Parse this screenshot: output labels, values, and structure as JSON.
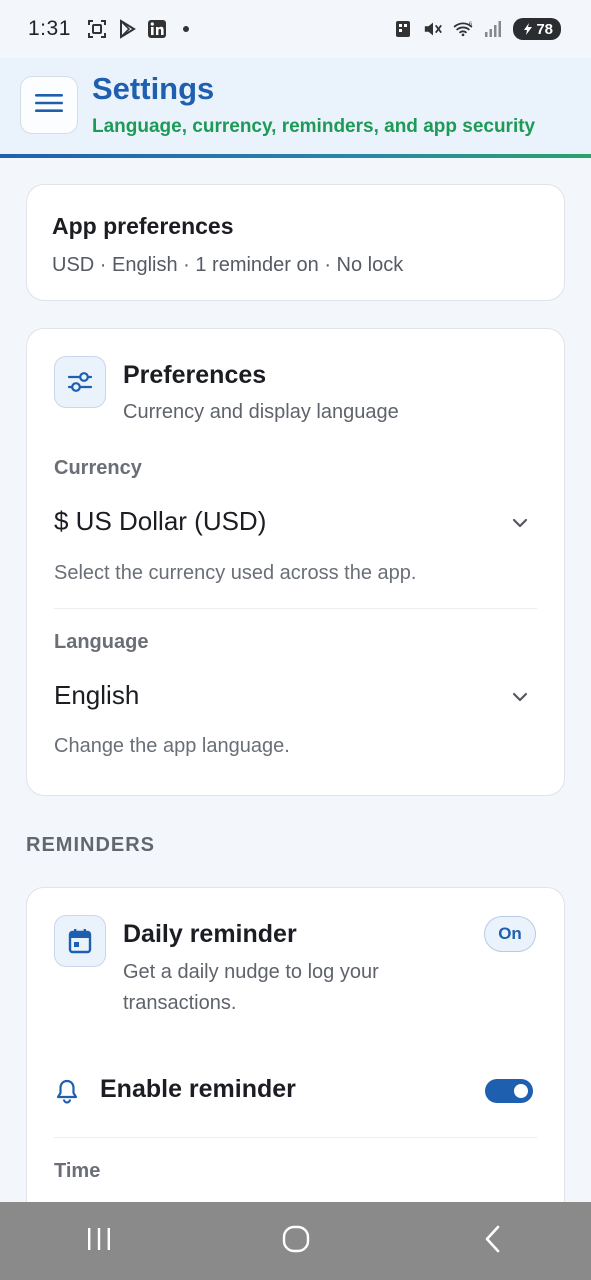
{
  "status_bar": {
    "time": "1:31",
    "battery": "78",
    "network": "6",
    "icons": [
      "screenshot-icon",
      "play-store-icon",
      "linkedin-icon",
      "notification-dot",
      "nfc-icon",
      "mute-icon",
      "wifi-icon",
      "signal-icon",
      "battery-icon"
    ]
  },
  "header": {
    "title": "Settings",
    "subtitle": "Language, currency, reminders, and app security",
    "menu_icon": "hamburger-icon"
  },
  "summary": {
    "title": "App preferences",
    "text": "USD · English · 1 reminder on · No lock"
  },
  "preferences": {
    "title": "Preferences",
    "subtitle": "Currency and display language",
    "icon": "sliders-icon",
    "currency": {
      "label": "Currency",
      "value": "$ US Dollar (USD)",
      "help": "Select the currency used across the app."
    },
    "language": {
      "label": "Language",
      "value": "English",
      "help": "Change the app language."
    }
  },
  "reminders_heading": "REMINDERS",
  "reminder": {
    "title": "Daily reminder",
    "subtitle": "Get a daily nudge to log your transactions.",
    "badge": "On",
    "icon": "calendar-icon",
    "enable_label": "Enable reminder",
    "enabled": true,
    "time_label": "Time"
  },
  "colors": {
    "accent": "#1f5fb0",
    "subtitle_green": "#1e9a57",
    "background": "#f3f6fb",
    "navbar": "#8a8a8a"
  }
}
